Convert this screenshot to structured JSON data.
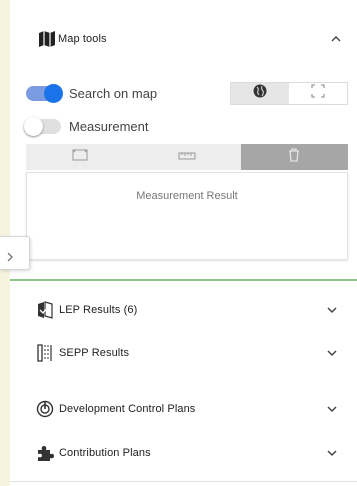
{
  "map_tools": {
    "title": "Map tools",
    "icon": "map-icon",
    "collapse_icon": "chevron-up-icon",
    "search_on_map": {
      "label": "Search on map",
      "on": true
    },
    "measurement": {
      "label": "Measurement",
      "on": false
    },
    "view_mode": {
      "options": [
        "globe-icon",
        "fullscreen-icon"
      ],
      "selected": "globe-icon"
    },
    "measure_tools": {
      "options": [
        "area-measure-icon",
        "ruler-icon",
        "trash-icon"
      ],
      "selected": "trash-icon"
    },
    "result_label": "Measurement Result"
  },
  "sections": [
    {
      "title": "LEP Results (6)",
      "icon": "lep-icon"
    },
    {
      "title": "SEPP Results",
      "icon": "sepp-icon"
    },
    {
      "title": "Development Control Plans",
      "icon": "dcp-icon"
    },
    {
      "title": "Contribution Plans",
      "icon": "puzzle-icon"
    }
  ],
  "colors": {
    "toggle_on_track": "#7b9be0",
    "toggle_on_knob": "#1a73e8",
    "map_green": "#8fc48a"
  }
}
